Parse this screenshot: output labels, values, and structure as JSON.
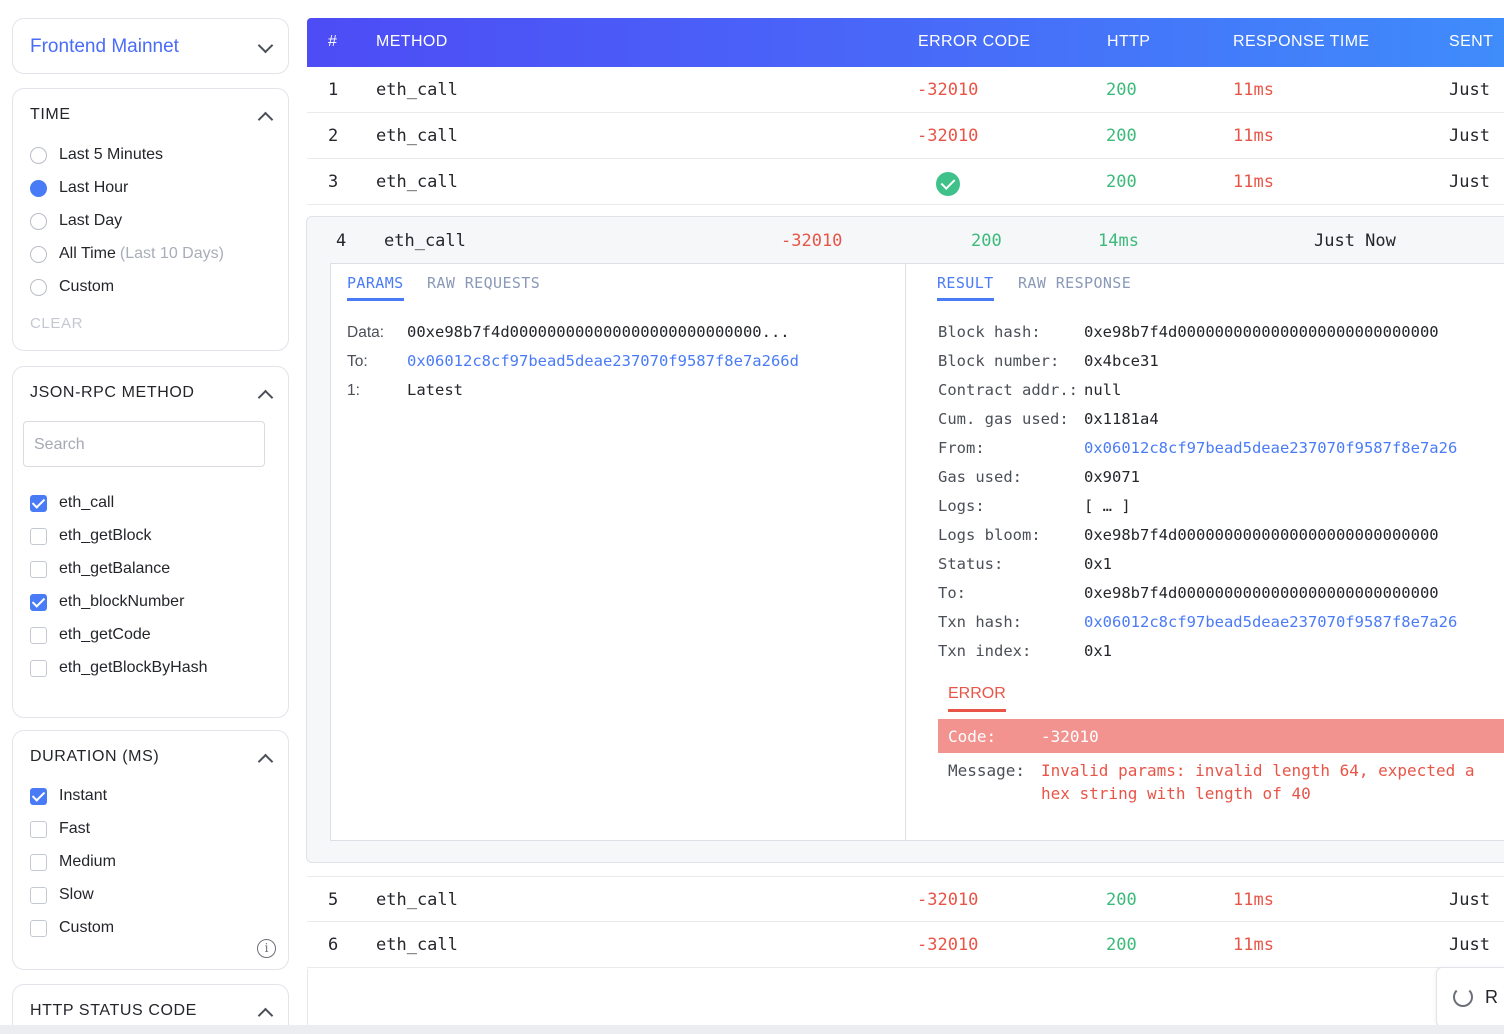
{
  "environment": {
    "label": "Frontend Mainnet"
  },
  "time": {
    "title": "TIME",
    "options": [
      {
        "label": "Last 5 Minutes",
        "selected": false
      },
      {
        "label": "Last Hour",
        "selected": true
      },
      {
        "label": "Last Day",
        "selected": false
      },
      {
        "label": "All Time",
        "hint": "(Last 10 Days)",
        "selected": false
      },
      {
        "label": "Custom",
        "selected": false
      }
    ],
    "clear_label": "CLEAR"
  },
  "rpc_method": {
    "title": "JSON-RPC METHOD",
    "search_placeholder": "Search",
    "options": [
      {
        "label": "eth_call",
        "checked": true
      },
      {
        "label": "eth_getBlock",
        "checked": false
      },
      {
        "label": "eth_getBalance",
        "checked": false
      },
      {
        "label": "eth_blockNumber",
        "checked": true
      },
      {
        "label": "eth_getCode",
        "checked": false
      },
      {
        "label": "eth_getBlockByHash",
        "checked": false
      }
    ]
  },
  "duration": {
    "title": "DURATION (MS)",
    "options": [
      {
        "label": "Instant",
        "checked": true
      },
      {
        "label": "Fast",
        "checked": false
      },
      {
        "label": "Medium",
        "checked": false
      },
      {
        "label": "Slow",
        "checked": false
      },
      {
        "label": "Custom",
        "checked": false
      }
    ],
    "info_icon": "i"
  },
  "http_status": {
    "title": "HTTP STATUS CODE"
  },
  "table": {
    "columns": {
      "num": "#",
      "method": "METHOD",
      "error_code": "ERROR CODE",
      "http": "HTTP",
      "response_time": "RESPONSE TIME",
      "sent": "SENT"
    },
    "rows": [
      {
        "num": "1",
        "method": "eth_call",
        "error_code": "-32010",
        "http": "200",
        "response_time": "11ms",
        "sent": "Just"
      },
      {
        "num": "2",
        "method": "eth_call",
        "error_code": "-32010",
        "http": "200",
        "response_time": "11ms",
        "sent": "Just"
      },
      {
        "num": "3",
        "method": "eth_call",
        "error_code": "",
        "http": "200",
        "response_time": "11ms",
        "sent": "Just",
        "success": true
      },
      {
        "num": "5",
        "method": "eth_call",
        "error_code": "-32010",
        "http": "200",
        "response_time": "11ms",
        "sent": "Just"
      },
      {
        "num": "6",
        "method": "eth_call",
        "error_code": "-32010",
        "http": "200",
        "response_time": "11ms",
        "sent": "Just"
      }
    ],
    "expanded": {
      "num": "4",
      "method": "eth_call",
      "error_code": "-32010",
      "http": "200",
      "response_time": "14ms",
      "sent": "Just Now",
      "left_tabs": [
        "PARAMS",
        "RAW REQUESTS"
      ],
      "params": [
        {
          "key": "Data:",
          "value": "00xe98b7f4d000000000000000000000000000..."
        },
        {
          "key": "To:",
          "value": "0x06012c8cf97bead5deae237070f9587f8e7a266d",
          "link": true
        },
        {
          "key": "1:",
          "value": "Latest"
        }
      ],
      "right_tabs": [
        "RESULT",
        "RAW RESPONSE"
      ],
      "result": [
        {
          "key": "Block hash:",
          "value": "0xe98b7f4d0000000000000000000000000000"
        },
        {
          "key": "Block number:",
          "value": "0x4bce31"
        },
        {
          "key": "Contract addr.:",
          "value": "null"
        },
        {
          "key": "Cum. gas used:",
          "value": "0x1181a4"
        },
        {
          "key": "From:",
          "value": "0x06012c8cf97bead5deae237070f9587f8e7a26",
          "link": true
        },
        {
          "key": "Gas used:",
          "value": "0x9071"
        },
        {
          "key": "Logs:",
          "value": "[ … ]"
        },
        {
          "key": "Logs bloom:",
          "value": "0xe98b7f4d0000000000000000000000000000"
        },
        {
          "key": "Status:",
          "value": "0x1"
        },
        {
          "key": "To:",
          "value": "0xe98b7f4d0000000000000000000000000000"
        },
        {
          "key": "Txn hash:",
          "value": "0x06012c8cf97bead5deae237070f9587f8e7a26",
          "link": true
        },
        {
          "key": "Txn index:",
          "value": "0x1"
        }
      ],
      "error": {
        "tab": "ERROR",
        "code_label": "Code:",
        "code": "-32010",
        "message_label": "Message:",
        "message_line1": "Invalid params: invalid length 64, expected a",
        "message_line2": "hex string with length of 40"
      }
    }
  },
  "refresh": {
    "label": "R"
  },
  "colors": {
    "accent": "#4a7bf7",
    "error": "#e85548",
    "success": "#3cba7a"
  }
}
